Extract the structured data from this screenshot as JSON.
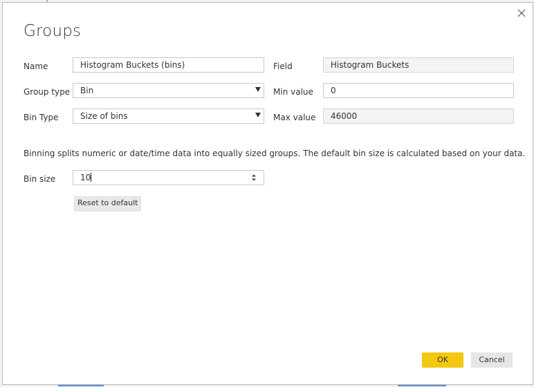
{
  "dialog": {
    "title": "Groups",
    "close_icon": "close-icon"
  },
  "form": {
    "name_label": "Name",
    "name_value": "Histogram Buckets (bins)",
    "field_label": "Field",
    "field_value": "Histogram Buckets",
    "group_type_label": "Group type",
    "group_type_value": "Bin",
    "min_value_label": "Min value",
    "min_value": "0",
    "bin_type_label": "Bin Type",
    "bin_type_value": "Size of bins",
    "max_value_label": "Max value",
    "max_value": "46000",
    "description": "Binning splits numeric or date/time data into equally sized groups. The default bin size is calculated based on your data.",
    "bin_size_label": "Bin size",
    "bin_size_value": "10",
    "reset_label": "Reset to default"
  },
  "buttons": {
    "ok_label": "OK",
    "cancel_label": "Cancel"
  },
  "colors": {
    "primary_button": "#f2c811",
    "secondary_button": "#e6e6e6"
  }
}
